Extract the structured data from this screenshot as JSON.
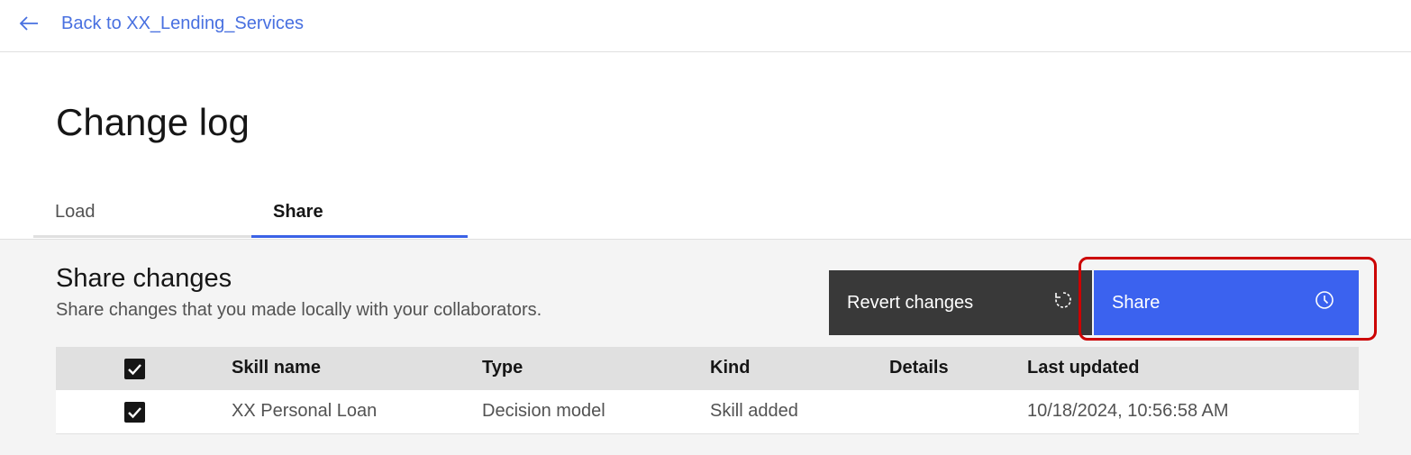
{
  "nav": {
    "back_label": "Back to XX_Lending_Services"
  },
  "page": {
    "title": "Change log"
  },
  "tabs": [
    {
      "label": "Load",
      "active": false
    },
    {
      "label": "Share",
      "active": true
    }
  ],
  "share_section": {
    "title": "Share changes",
    "description": "Share changes that you made locally with your collaborators.",
    "revert_button": {
      "label": "Revert changes",
      "icon": "reset-icon"
    },
    "share_button": {
      "label": "Share",
      "icon": "clock-icon"
    }
  },
  "table": {
    "header_checked": true,
    "columns": [
      "Skill name",
      "Type",
      "Kind",
      "Details",
      "Last updated"
    ],
    "rows": [
      {
        "checked": true,
        "skill_name": "XX Personal Loan",
        "type": "Decision model",
        "kind": "Skill added",
        "details": "",
        "last_updated": "10/18/2024, 10:56:58 AM"
      }
    ]
  },
  "colors": {
    "link": "#4870e0",
    "primary": "#3b62ef",
    "secondary": "#393939",
    "highlight": "#cc0000"
  }
}
